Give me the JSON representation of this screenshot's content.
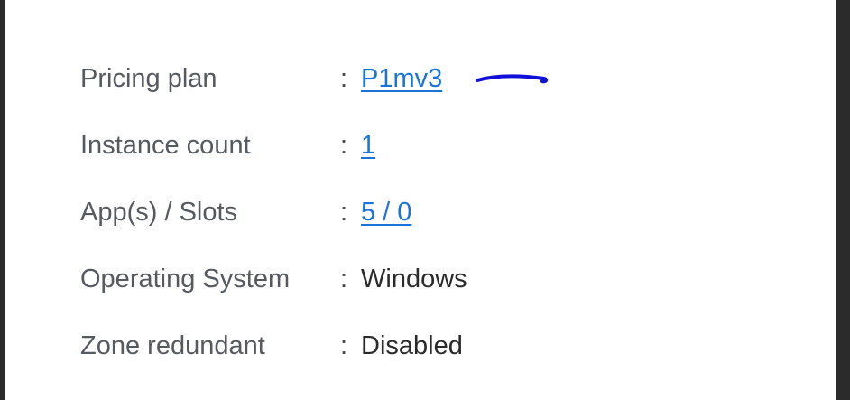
{
  "properties": [
    {
      "label": "Pricing plan",
      "value": "P1mv3",
      "is_link": true
    },
    {
      "label": "Instance count",
      "value": "1",
      "is_link": true
    },
    {
      "label": "App(s) / Slots",
      "value": "5 / 0",
      "is_link": true
    },
    {
      "label": "Operating System",
      "value": "Windows",
      "is_link": false
    },
    {
      "label": "Zone redundant",
      "value": "Disabled",
      "is_link": false
    }
  ],
  "separator": ":",
  "colors": {
    "link": "#1a73d9",
    "label": "#555a60",
    "annotation_stroke": "#1010d8",
    "frame": "#2b2b2b"
  }
}
